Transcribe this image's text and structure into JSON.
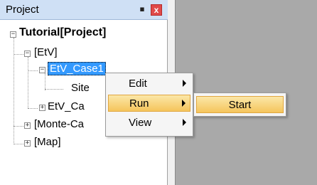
{
  "panel": {
    "title": "Project",
    "pin_icon": "pin-icon",
    "close_icon": "close-icon",
    "close_glyph": "x"
  },
  "tree": {
    "root": "Tutorial[Project]",
    "etv": "[EtV]",
    "case1": "EtV_Case1",
    "site": "Site",
    "case2": "EtV_Ca",
    "monte": "[Monte-Ca",
    "map": "[Map]"
  },
  "context_menu": {
    "items": [
      {
        "label": "Edit"
      },
      {
        "label": "Run"
      },
      {
        "label": "View"
      }
    ]
  },
  "submenu": {
    "items": [
      {
        "label": "Start"
      }
    ]
  }
}
